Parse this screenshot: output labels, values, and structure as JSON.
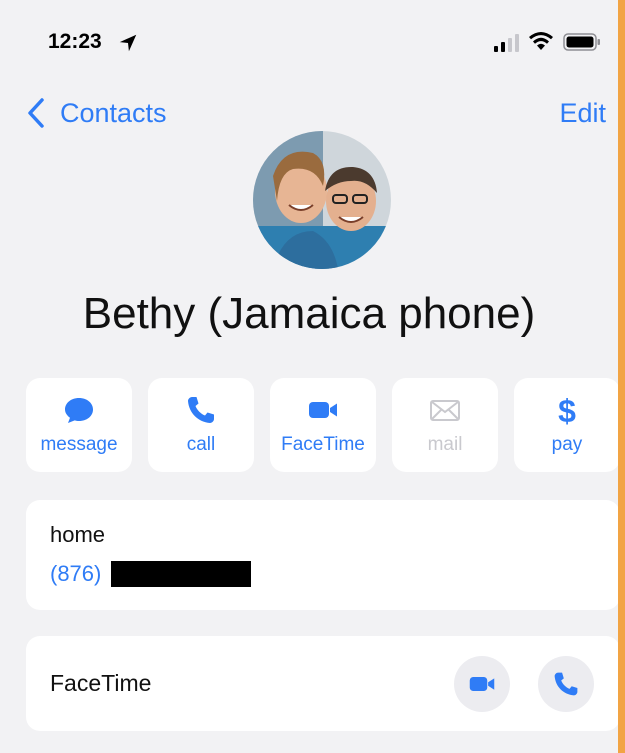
{
  "status_bar": {
    "time": "12:23",
    "icons": [
      "location-arrow-icon",
      "cellular-signal-icon",
      "wifi-icon",
      "battery-icon"
    ]
  },
  "nav": {
    "back_label": "Contacts",
    "edit_label": "Edit"
  },
  "contact": {
    "name": "Bethy (Jamaica phone)"
  },
  "actions": [
    {
      "label": "message",
      "icon": "message-bubble-icon",
      "enabled": true
    },
    {
      "label": "call",
      "icon": "phone-icon",
      "enabled": true
    },
    {
      "label": "FaceTime",
      "icon": "video-camera-icon",
      "enabled": true
    },
    {
      "label": "mail",
      "icon": "envelope-icon",
      "enabled": false
    },
    {
      "label": "pay",
      "icon": "dollar-icon",
      "enabled": true
    }
  ],
  "phone_entry": {
    "label": "home",
    "number_visible": "(876)"
  },
  "facetime_row": {
    "label": "FaceTime",
    "buttons": [
      "video-camera-icon",
      "phone-icon"
    ]
  },
  "colors": {
    "accent": "#2f7cf6",
    "disabled": "#c9c9ce",
    "background": "#f2f2f4",
    "frame": "#f2a444"
  }
}
